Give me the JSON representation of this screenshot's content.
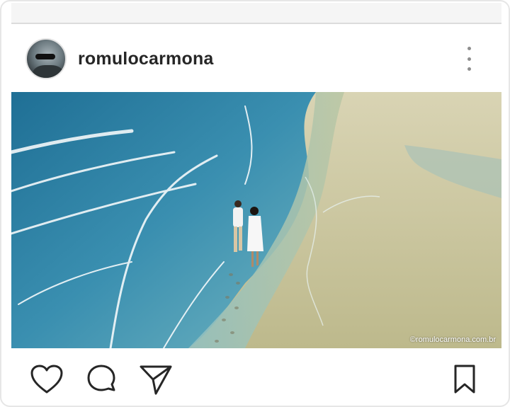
{
  "post": {
    "username": "romulocarmona",
    "photo_watermark": "©romulocarmona.com.br",
    "photo_alt": "Couple walking along the beach shoreline, aerial view"
  },
  "icons": {
    "more": "more-vertical-icon",
    "like": "heart-icon",
    "comment": "comment-icon",
    "share": "send-icon",
    "save": "bookmark-icon"
  },
  "colors": {
    "text": "#262626",
    "icon": "#262626",
    "muted": "#8e8e8e",
    "sea": "#2f7ea0",
    "sand": "#c9c59a"
  }
}
